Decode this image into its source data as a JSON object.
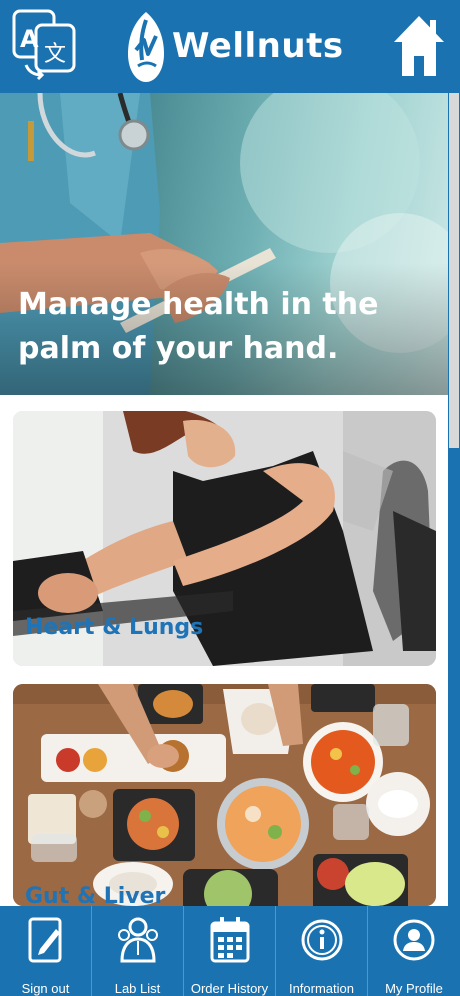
{
  "header": {
    "brand_name": "Wellnuts",
    "translate_icon": "translate-icon",
    "home_icon": "home-icon",
    "logo_icon": "wellnuts-logo-icon"
  },
  "hero": {
    "headline": "Manage health in the palm of your hand."
  },
  "cards": [
    {
      "title": "Heart & Lungs"
    },
    {
      "title": "Gut & Liver"
    }
  ],
  "bottom_nav": [
    {
      "label": "Sign out",
      "icon": "sign-out-icon"
    },
    {
      "label": "Lab List",
      "icon": "lab-list-icon"
    },
    {
      "label": "Order History",
      "icon": "calendar-icon"
    },
    {
      "label": "Information",
      "icon": "information-icon"
    },
    {
      "label": "My Profile",
      "icon": "profile-icon"
    }
  ],
  "colors": {
    "primary": "#1a73b0",
    "card_title": "#1f73b7",
    "text_light": "#ffffff"
  }
}
